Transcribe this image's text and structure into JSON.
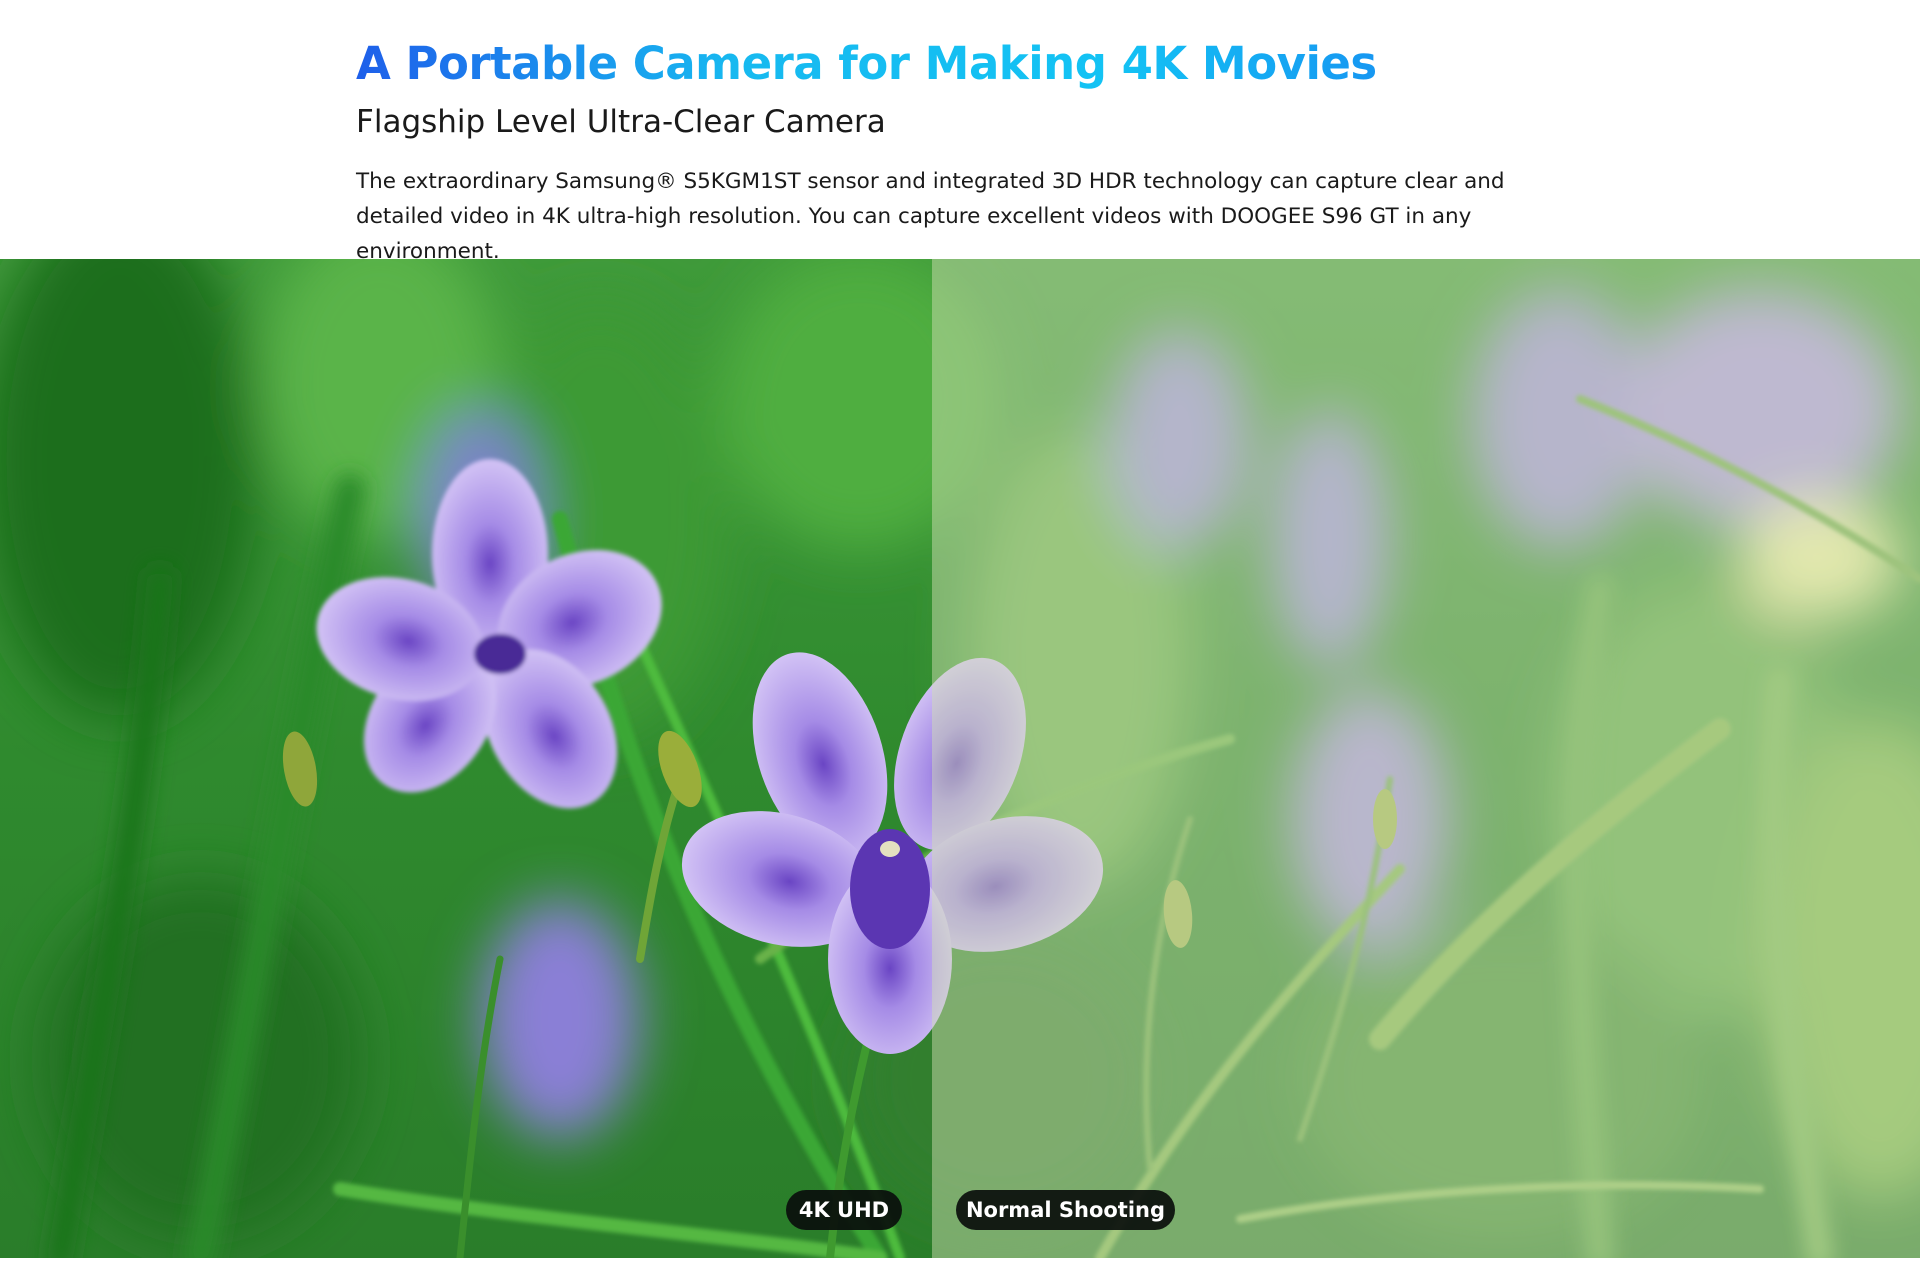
{
  "header": {
    "headline": "A Portable Camera for Making 4K Movies",
    "subheadline": "Flagship Level Ultra-Clear Camera",
    "description": "The extraordinary Samsung® S5KGM1ST sensor and integrated 3D HDR technology can capture clear and detailed video in 4K ultra-high resolution. You can capture excellent videos with DOOGEE S96 GT in any environment."
  },
  "comparison": {
    "left_label": "4K UHD",
    "right_label": "Normal Shooting"
  },
  "colors": {
    "headline_gradient_start": "#1e5fea",
    "headline_gradient_mid": "#13c3f4",
    "headline_gradient_end": "#1a6ff0",
    "pill_background": "#0a0e0c",
    "body_text": "#1a1a1a"
  }
}
